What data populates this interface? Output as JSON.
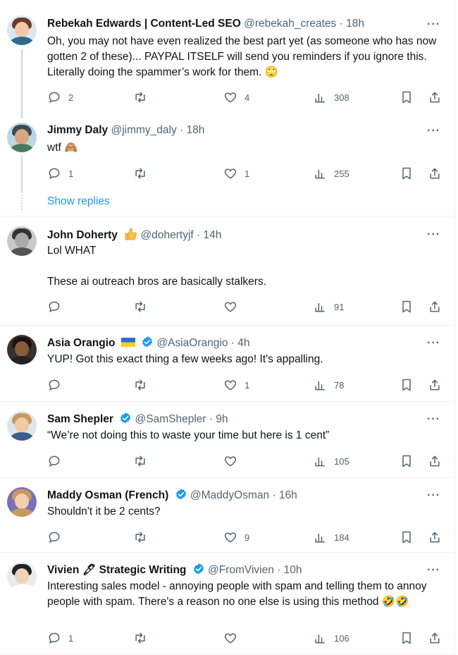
{
  "tweets": [
    {
      "name": "Rebekah Edwards | Content-Led SEO",
      "handle": "@rebekah_creates",
      "time": "18h",
      "text": "Oh, you may not have even realized the best part yet (as someone who has now gotten 2 of these)... PAYPAL ITSELF will send you reminders if you ignore this. Literally doing the spammer’s work for them. 🙄",
      "replies": "2",
      "retweets": "",
      "likes": "4",
      "views": "308"
    },
    {
      "name": "Jimmy Daly",
      "handle": "@jimmy_daly",
      "time": "18h",
      "text": "wtf 🙈",
      "replies": "1",
      "retweets": "",
      "likes": "1",
      "views": "255"
    },
    {
      "name": "John Doherty",
      "handle": "@dohertyjf",
      "time": "14h",
      "text": "Lol WHAT\n\nThese ai outreach bros are basically stalkers.",
      "replies": "",
      "retweets": "",
      "likes": "",
      "views": "91"
    },
    {
      "name": "Asia Orangio",
      "handle": "@AsiaOrangio",
      "time": "4h",
      "text": "YUP! Got this exact thing a few weeks ago! It's appalling.",
      "replies": "",
      "retweets": "",
      "likes": "1",
      "views": "78"
    },
    {
      "name": "Sam Shepler",
      "handle": "@SamShepler",
      "time": "9h",
      "text": "“We’re not doing this to waste your time but here is 1 cent”",
      "replies": "",
      "retweets": "",
      "likes": "",
      "views": "105"
    },
    {
      "name": "Maddy Osman (French)",
      "handle": "@MaddyOsman",
      "time": "16h",
      "text": "Shouldn't it be 2 cents?",
      "replies": "",
      "retweets": "",
      "likes": "9",
      "views": "184"
    },
    {
      "name": "Vivien 🖋 Strategic Writing",
      "handle": "@FromVivien",
      "time": "10h",
      "text": "Interesting sales model - annoying people with spam and telling them to annoy people with spam. There's a reason no one else is using this method 🤣🤣",
      "replies": "1",
      "retweets": "",
      "likes": "",
      "views": "106"
    }
  ],
  "thread": {
    "show_replies": "Show replies"
  },
  "ui": {
    "dot": "·",
    "more": "···"
  },
  "icons": {
    "reply": "reply-icon",
    "retweet": "retweet-icon",
    "like": "heart-icon",
    "views": "views-chart-icon",
    "bookmark": "bookmark-icon",
    "share": "share-icon",
    "verified": "verified-badge-icon",
    "more": "more-options-icon",
    "john_emoji": "thumbs-up-emoji",
    "asia_flag": "ukraine-flag"
  },
  "colors": {
    "link": "#1d9bf0",
    "verified": "#1d9bf0",
    "muted": "#536471",
    "text": "#0f1419",
    "divider": "#eff3f4"
  }
}
